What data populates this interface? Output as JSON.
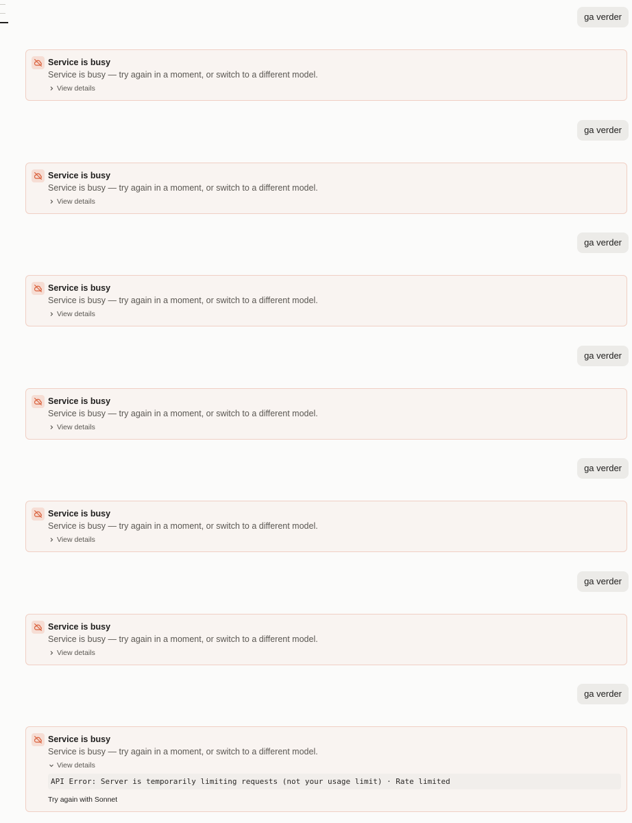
{
  "user_message": "ga verder",
  "error": {
    "title": "Service is busy",
    "message": "Service is busy — try again in a moment, or switch to a different model.",
    "details_label": "View details",
    "api_error": "API Error: Server is temporarily limiting requests (not your usage limit) · Rate limited",
    "retry_label": "Try again with Sonnet"
  },
  "icons": {
    "error": "cloud-off-icon",
    "collapsed": "chevron-right-icon",
    "expanded": "chevron-down-icon"
  },
  "colors": {
    "card_bg": "#f9f4f1",
    "card_border": "#f0cfc4",
    "icon_accent": "#d9603c",
    "bubble_bg": "#ecebe8"
  }
}
